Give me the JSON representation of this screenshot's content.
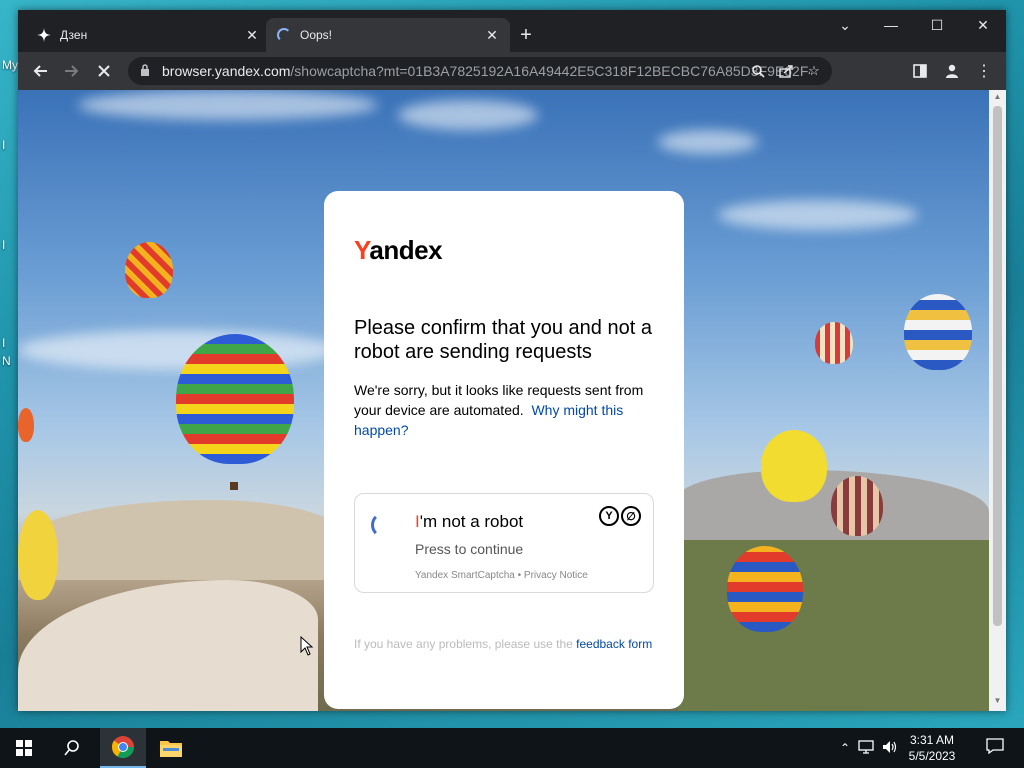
{
  "desktop": {
    "labels": [
      "My",
      "I",
      "I",
      "I",
      "N"
    ]
  },
  "browser": {
    "tabs": [
      {
        "title": "Дзен",
        "icon": "zen-star-icon"
      },
      {
        "title": "Oops!",
        "icon": "loading-spinner-icon"
      }
    ],
    "url_host": "browser.yandex.com",
    "url_path": "/showcaptcha?mt=01B3A7825192A16A49442E5C318F12BECBC76A85D3F9E62F4..."
  },
  "captcha_page": {
    "logo": {
      "first": "Y",
      "rest": "andex"
    },
    "headline": "Please confirm that you and not a robot are sending requests",
    "body": "We're sorry, but it looks like requests sent from your device are automated.",
    "why_link": "Why might this happen?",
    "widget": {
      "title_accent": "I",
      "title_rest": "'m not a robot",
      "subtitle": "Press to continue",
      "footer": "Yandex SmartCaptcha • Privacy Notice",
      "badge_left": "Y",
      "badge_right": "∅"
    },
    "feedback_text": "If you have any problems, please use the",
    "feedback_link": "feedback form"
  },
  "taskbar": {
    "time": "3:31 AM",
    "date": "5/5/2023"
  },
  "colors": {
    "yandex_red": "#fc3f1d",
    "link_blue": "#0049a9",
    "chrome_dark": "#202124"
  }
}
